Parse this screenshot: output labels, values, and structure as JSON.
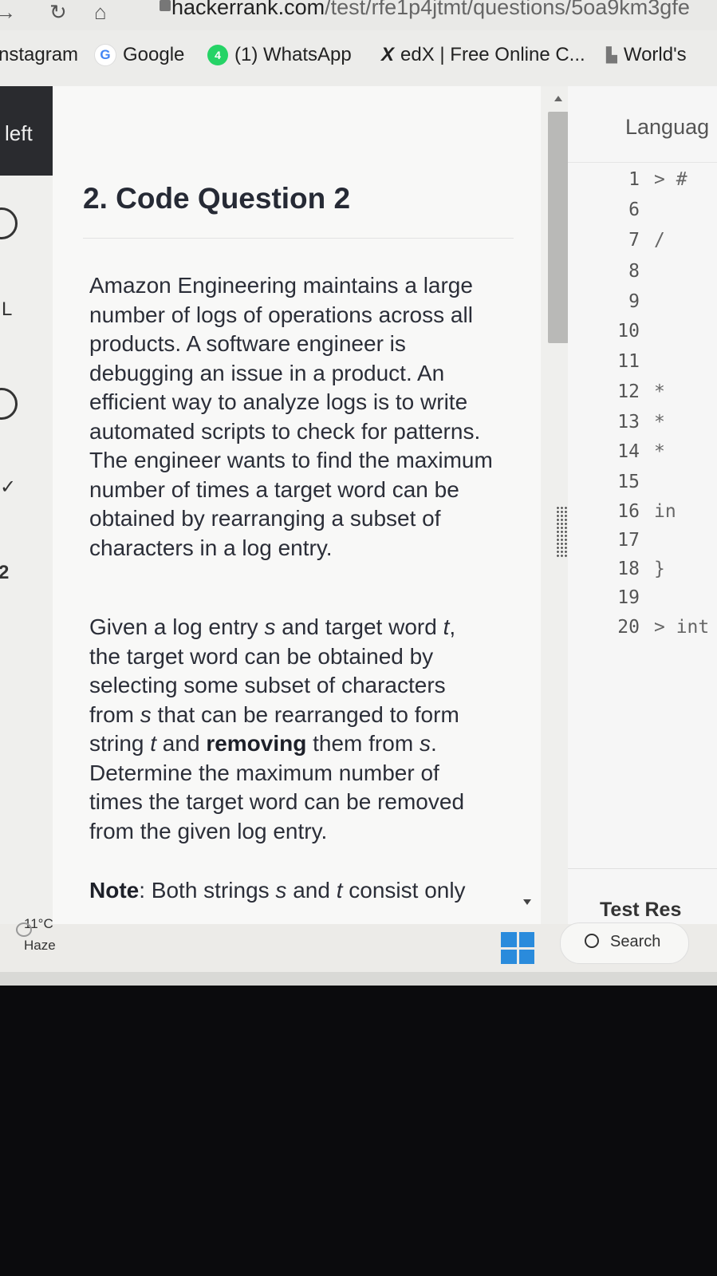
{
  "browser": {
    "url_host": "hackerrank.com",
    "url_path": "/test/rfe1p4jtmt/questions/5oa9km3gfe"
  },
  "bookmarks": [
    {
      "label": "nstagram",
      "icon": "instagram-icon"
    },
    {
      "label": "Google",
      "icon": "google-icon"
    },
    {
      "label": "(1) WhatsApp",
      "icon": "whatsapp-icon"
    },
    {
      "label": "edX | Free Online C...",
      "icon": "edx-icon"
    },
    {
      "label": "World's",
      "icon": "worlds-icon"
    }
  ],
  "sidebar": {
    "left_label": "left",
    "marks": [
      "L",
      "2"
    ]
  },
  "question": {
    "title": "2. Code Question 2",
    "p1": "Amazon Engineering maintains a large number of logs of operations across all products. A software engineer is debugging an issue in a product. An efficient way to analyze logs is to write automated scripts to check for patterns. The engineer wants to find the maximum number of times a target word can be obtained by rearranging a subset of characters in a log entry.",
    "p2_a": "Given a log entry ",
    "p2_s1": "s",
    "p2_b": " and target word ",
    "p2_t1": "t",
    "p2_c": ", the target word can be obtained by selecting some subset of characters from ",
    "p2_s2": "s",
    "p2_d": " that can be rearranged to form string ",
    "p2_t2": "t",
    "p2_e": " and ",
    "p2_bold": "removing",
    "p2_f": " them from ",
    "p2_s3": "s",
    "p2_g": ". Determine the maximum number of times the target word can be removed from the given log entry.",
    "note_label": "Note",
    "note_a": ": Both strings ",
    "note_s": "s",
    "note_b": " and ",
    "note_t": "t",
    "note_c": " consist only"
  },
  "editor": {
    "language_label": "Languag",
    "lines": [
      {
        "num": "1",
        "code": "> #"
      },
      {
        "num": "6",
        "code": ""
      },
      {
        "num": "7",
        "code": "/"
      },
      {
        "num": "8",
        "code": ""
      },
      {
        "num": "9",
        "code": ""
      },
      {
        "num": "10",
        "code": ""
      },
      {
        "num": "11",
        "code": ""
      },
      {
        "num": "12",
        "code": "*"
      },
      {
        "num": "13",
        "code": "*"
      },
      {
        "num": "14",
        "code": "*"
      },
      {
        "num": "15",
        "code": ""
      },
      {
        "num": "16",
        "code": "in"
      },
      {
        "num": "17",
        "code": ""
      },
      {
        "num": "18",
        "code": "}"
      },
      {
        "num": "19",
        "code": ""
      },
      {
        "num": "20",
        "code": "> int"
      }
    ],
    "test_results_label": "Test Res"
  },
  "taskbar": {
    "temperature": "11°C",
    "condition": "Haze",
    "search_label": "Search"
  },
  "colors": {
    "accent_start": "#2a8bdc",
    "whatsapp": "#25d366",
    "dark_tab": "#2a2b2f"
  }
}
